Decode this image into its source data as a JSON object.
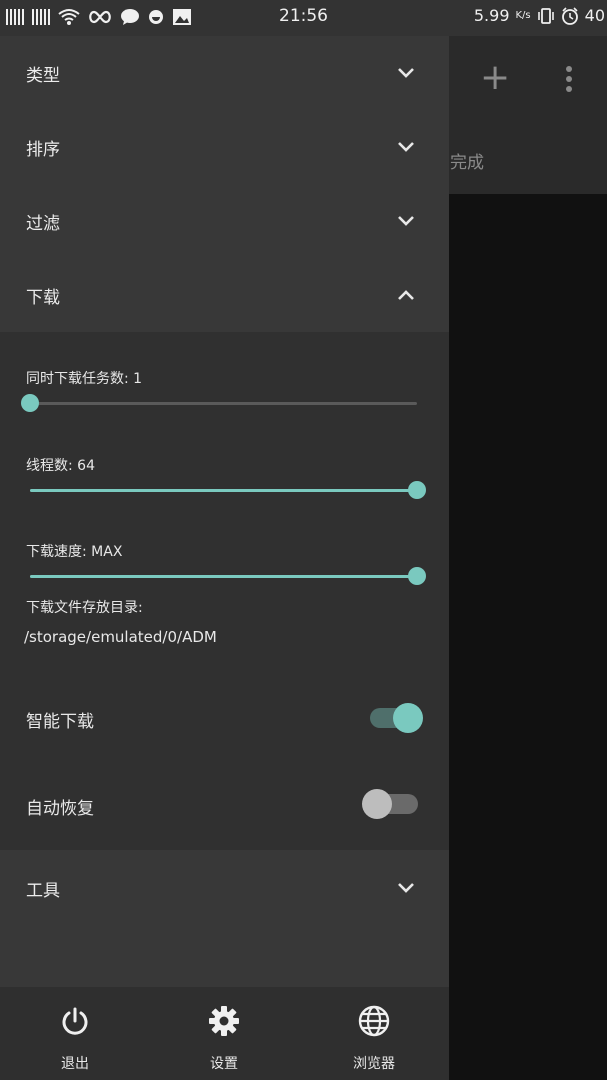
{
  "status_bar": {
    "time": "21:56",
    "net_speed": "5.99",
    "net_unit": "K/s",
    "battery": "40"
  },
  "background_app": {
    "status_text": "完成"
  },
  "drawer": {
    "sections": [
      {
        "label": "类型",
        "expanded": false
      },
      {
        "label": "排序",
        "expanded": false
      },
      {
        "label": "过滤",
        "expanded": false
      },
      {
        "label": "下载",
        "expanded": true
      },
      {
        "label": "工具",
        "expanded": false
      }
    ],
    "download_panel": {
      "concurrent_label": "同时下载任务数: 1",
      "concurrent_value": 1,
      "concurrent_max": 10,
      "threads_label": "线程数: 64",
      "threads_fraction": 1.0,
      "speed_label": "下载速度: MAX",
      "speed_fraction": 1.0,
      "dir_label": "下载文件存放目录:",
      "dir_value": "/storage/emulated/0/ADM",
      "smart_download_label": "智能下载",
      "smart_download_on": true,
      "auto_resume_label": "自动恢复",
      "auto_resume_on": false
    },
    "bottom_bar": {
      "exit_label": "退出",
      "settings_label": "设置",
      "browser_label": "浏览器"
    }
  },
  "colors": {
    "accent": "#7ac9bf",
    "drawer_bg": "#383838",
    "panel_bg": "#303030"
  }
}
